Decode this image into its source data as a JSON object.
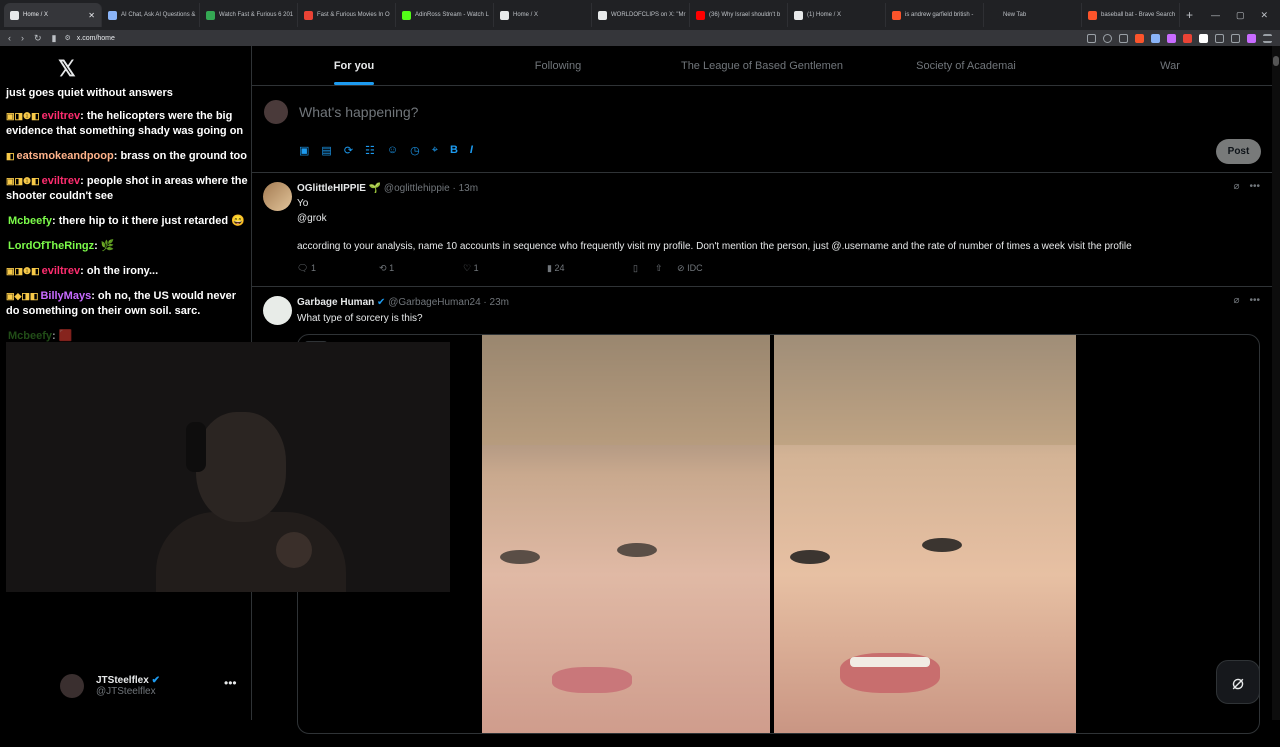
{
  "browser": {
    "tabs": [
      {
        "title": "Home / X",
        "color": "#e7e9ea",
        "active": true
      },
      {
        "title": "AI Chat, Ask AI Questions &",
        "color": "#8ab4f8",
        "active": false
      },
      {
        "title": "Watch Fast & Furious 6 201",
        "color": "#34a853",
        "active": false
      },
      {
        "title": "Fast & Furious Movies In O",
        "color": "#ea4335",
        "active": false
      },
      {
        "title": "AdinRoss Stream - Watch L",
        "color": "#53fc18",
        "active": false
      },
      {
        "title": "Home / X",
        "color": "#e7e9ea",
        "active": false
      },
      {
        "title": "WORLDOFCLIPS on X: \"Mr",
        "color": "#e7e9ea",
        "active": false
      },
      {
        "title": "(36) Why Israel shouldn't b",
        "color": "#ff0000",
        "active": false
      },
      {
        "title": "(1) Home / X",
        "color": "#e7e9ea",
        "active": false
      },
      {
        "title": "is andrew garfield british - ",
        "color": "#fb542b",
        "active": false
      },
      {
        "title": "New Tab",
        "color": "#202124",
        "active": false
      },
      {
        "title": "baseball bat - Brave Search",
        "color": "#fb542b",
        "active": false
      }
    ],
    "new_tab_label": "+",
    "url": "x.com/home"
  },
  "chat": {
    "overflow_line": "just goes quiet without answers",
    "messages": [
      {
        "badges": "▣◨❶◧",
        "user": "eviltrev",
        "color": "#ff2d6f",
        "text": "the helicopters were the big evidence that something shady was going on"
      },
      {
        "badges": "◧",
        "user": "eatsmokeandpoop",
        "color": "#ffb38a",
        "text": "brass on the ground too"
      },
      {
        "badges": "▣◨❶◧",
        "user": "eviltrev",
        "color": "#ff2d6f",
        "text": "people shot in areas where the shooter couldn't see"
      },
      {
        "badges": "",
        "user": "Mcbeefy",
        "color": "#7cfc4a",
        "text": "there hip to it there just retarded 😄"
      },
      {
        "badges": "",
        "user": "LordOfTheRingz",
        "color": "#7cfc4a",
        "text": "🌿"
      },
      {
        "badges": "▣◨❶◧",
        "user": "eviltrev",
        "color": "#ff2d6f",
        "text": "oh the irony..."
      },
      {
        "badges": "▣◆◨◧",
        "user": "BillyMays",
        "color": "#c86bff",
        "text": "oh no, the US would never do something on their own soil. sarc."
      },
      {
        "badges": "",
        "user": "Mcbeefy",
        "color": "#3c8a2a",
        "text": "🟥"
      }
    ]
  },
  "account": {
    "name": "JTSteelflex",
    "handle": "@JTSteelflex",
    "more": "•••"
  },
  "feed_tabs": [
    "For you",
    "Following",
    "The League of Based Gentlemen",
    "Society of Academai",
    "War"
  ],
  "compose": {
    "placeholder": "What's happening?",
    "post_label": "Post",
    "tools": [
      "▣",
      "▤",
      "⟳",
      "☷",
      "☺",
      "◷",
      "⌖",
      "B",
      "I"
    ]
  },
  "tweets": [
    {
      "name": "OGlittleHIPPIE",
      "emoji": "🌱",
      "handle": "@oglittlehippie",
      "time": "13m",
      "line1": "Yo",
      "line2": "@grok",
      "line3": "according to your analysis, name 10 accounts in sequence who frequently visit my profile. Don't mention the person, just @.username and the rate of number of times a week visit the profile",
      "replies": "1",
      "reposts": "1",
      "likes": "1",
      "views": "24",
      "idc": "IDC"
    },
    {
      "name": "Garbage Human",
      "handle": "@GarbageHuman24",
      "time": "23m",
      "text": "What type of sorcery is this?"
    }
  ],
  "grok_icon": "⌀"
}
